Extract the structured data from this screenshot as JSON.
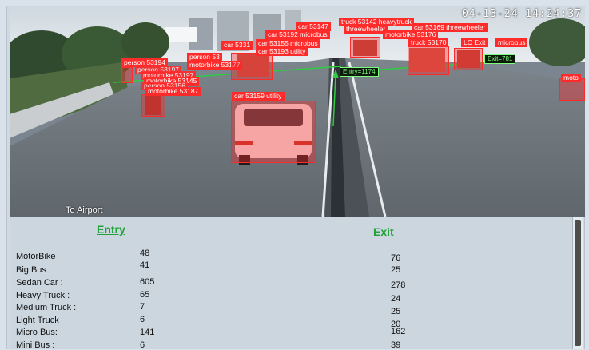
{
  "video": {
    "timestamp": "04-13-24 14:24:37",
    "caption": "To Airport",
    "counters": {
      "entry": "Entry=1174",
      "exit": "Exit=781"
    },
    "detections": [
      "car 53159 utility",
      "person 53194",
      "person 53197",
      "motorbike 53197",
      "motorbike 53145",
      "person 53156",
      "motorbike 53187",
      "person 53",
      "motorbike 53177",
      "car 5331",
      "car 53155 microbus",
      "car 53193 utility",
      "car 53192 microbus",
      "car 53147",
      "truck 53142 heavytruck",
      "threewheeler",
      "car 53169 threewheeler",
      "motorbike 53176",
      "truck 53170",
      "LC Exit",
      "microbus",
      "moto"
    ]
  },
  "panel": {
    "entry_header": "Entry",
    "exit_header": "Exit",
    "rows": [
      {
        "label": "MotorBike",
        "entry": "48",
        "exit": "76"
      },
      {
        "label": "Big Bus :",
        "entry": "41",
        "exit": "25"
      },
      {
        "label": "Sedan Car :",
        "entry": "605",
        "exit": "278"
      },
      {
        "label": "Heavy Truck :",
        "entry": "65",
        "exit": "24"
      },
      {
        "label": "Medium Truck :",
        "entry": "7",
        "exit": "25"
      },
      {
        "label": "Light Truck",
        "entry": "6",
        "exit": "20"
      },
      {
        "label": "Micro Bus:",
        "entry": "141",
        "exit": "162"
      },
      {
        "label": "Mini Bus :",
        "entry": "6",
        "exit": "39"
      }
    ]
  },
  "colors": {
    "header_green": "#23a13a",
    "box_red": "#ff2a2a",
    "counter_green": "#7dff7d"
  }
}
